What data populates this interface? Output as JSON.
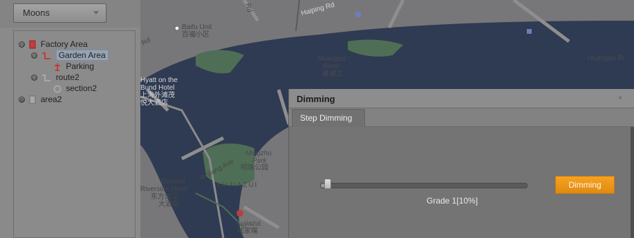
{
  "sidebar": {
    "selector_label": "Moons",
    "tree": [
      {
        "label": "Factory Area",
        "toggle": "⊖"
      },
      {
        "label": "Garden Area",
        "toggle": "⊖"
      },
      {
        "label": "Parking",
        "toggle": ""
      },
      {
        "label": "route2",
        "toggle": "⊖"
      },
      {
        "label": "section2",
        "toggle": ""
      },
      {
        "label": "area2",
        "toggle": "⊕"
      }
    ]
  },
  "map": {
    "labels": {
      "baifu_en": "Baifu Unit",
      "baifu_cn": "百福小区",
      "haiping": "Haiping Rd",
      "huangpu_en1": "Huangpu",
      "huangpu_en2": "River",
      "huangpu_cn": "黄浦江",
      "huangpu_right": "Huangpu Ri",
      "hyatt1": "Hyatt on the",
      "hyatt2": "Bund Hotel",
      "hyatt_cn1": "上海外滩茂",
      "hyatt_cn2": "悦大酒店",
      "mingzhu1": "Mingzhu",
      "mingzhu2": "Park",
      "mingzhu_cn": "明珠公园",
      "binjiang": "Binjiang Ave",
      "lujiazui": "LUJIAZUI",
      "oriental1": "Oriental",
      "oriental2": "Riverside Hotel",
      "oriental_cn1": "东方滨江",
      "oriental_cn2": "大酒店",
      "lujiazui_st": "Lujiazui",
      "lujiazui_st_cn": "陆家嘴",
      "road_rd": "Rd"
    }
  },
  "dialog": {
    "title": "Dimming",
    "close_glyph": "×",
    "tab_label": "Step Dimming",
    "slider_value_fraction": 0.02,
    "grade_text": "Grade 1[10%]",
    "button_label": "Dimming"
  },
  "colors": {
    "accent": "#f39c1e",
    "water": "#2f3b52",
    "land": "#77777a",
    "park": "#4f6e56"
  }
}
